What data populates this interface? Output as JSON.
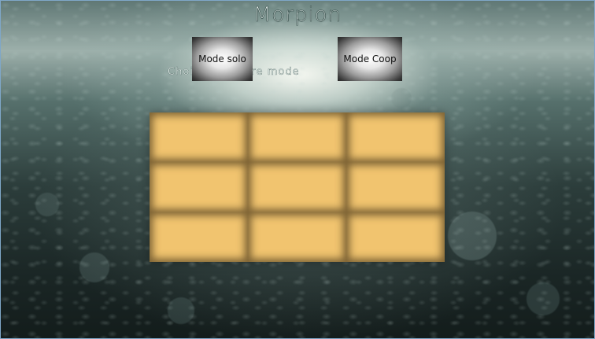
{
  "app": {
    "title": "Morpion"
  },
  "mode_selection": {
    "prompt": "Choisissez votre mode",
    "buttons": [
      {
        "label": "Mode solo"
      },
      {
        "label": "Mode Coop"
      }
    ]
  },
  "board": {
    "rows": 3,
    "columns": 3,
    "cells": [
      [
        "",
        "",
        ""
      ],
      [
        "",
        "",
        ""
      ],
      [
        "",
        "",
        ""
      ]
    ]
  },
  "colors": {
    "cell": "#f1c46f",
    "title_text": "#eef6f4"
  }
}
